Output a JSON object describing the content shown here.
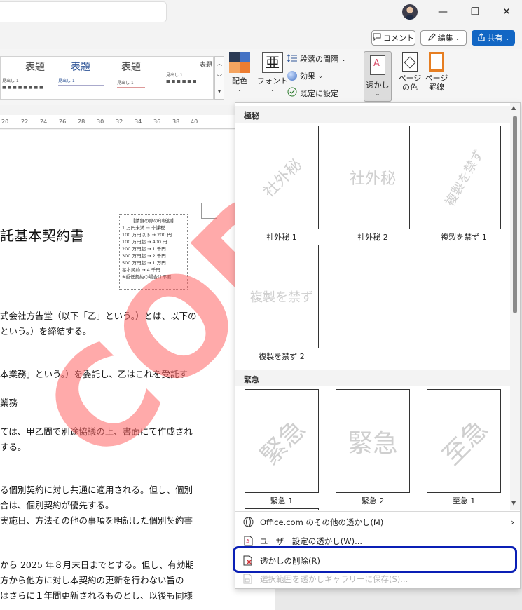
{
  "window": {
    "minimize_glyph": "—",
    "restore_glyph": "❐",
    "close_glyph": "✕"
  },
  "collab": {
    "comment_label": "コメント",
    "edit_label": "編集",
    "share_label": "共有"
  },
  "ribbon": {
    "styles": [
      {
        "title": "表題",
        "sub": "見出し 1"
      },
      {
        "title": "表題",
        "sub": "見出し 1"
      },
      {
        "title": "表題",
        "sub": "見出し 1"
      },
      {
        "title": "表題",
        "sub": "見出し 1"
      }
    ],
    "colors_label": "配色",
    "fonts_label": "フォント",
    "font_glyph": "亜",
    "paragraph_spacing_label": "段落の間隔",
    "effects_label": "効果",
    "set_default_label": "既定に設定",
    "watermark_label": "透かし",
    "page_color_label": "ページの色",
    "page_borders_label": "ページ罫線"
  },
  "ruler": {
    "ticks": [
      "20",
      "22",
      "24",
      "26",
      "28",
      "30",
      "32",
      "34",
      "36",
      "38",
      "40"
    ]
  },
  "document": {
    "title": "託基本契約書",
    "stamp_lines": [
      "【請負の際の印紙額】",
      "1 万円未満 → 非課税",
      "100 万円以下 → 200 円",
      "100 万円超 → 400 円",
      "200 万円超 → 1 千円",
      "300 万円超 → 2 千円",
      "500 万円超 → 1 万円",
      "基本契約 → 4 千円",
      "※委任契約の場合は不要"
    ],
    "lines": [
      "式会社方告堂（以下「乙」という。）とは、以下の",
      "という。）を締結する。",
      "本業務」という。）を委託し、乙はこれを受託す",
      "業務",
      "ては、甲乙間で別途協議の上、書面にて作成され",
      "する。",
      "る個別契約に対し共通に適用される。但し、個別",
      "合は、個別契約が優先する。",
      "実施日、方法その他の事項を明記した個別契約書",
      "から 2025 年８月末日までとする。但し、有効期",
      "方から他方に対し本契約の更新を行わない旨の",
      "はさらに１年間更新されるものとし、以後も同様"
    ],
    "watermark_text": "COPY"
  },
  "watermark_menu": {
    "sections": [
      {
        "heading": "極秘",
        "items": [
          {
            "text": "社外秘",
            "caption": "社外秘 1",
            "style": "diagonal"
          },
          {
            "text": "社外秘",
            "caption": "社外秘 2",
            "style": "horizontal"
          },
          {
            "text": "複製を禁ず",
            "caption": "複製を禁ず 1",
            "style": "diagonal"
          },
          {
            "text": "複製を禁ず",
            "caption": "複製を禁ず 2",
            "style": "horizontal"
          }
        ]
      },
      {
        "heading": "緊急",
        "items": [
          {
            "text": "緊急",
            "caption": "緊急 1",
            "style": "diagonal"
          },
          {
            "text": "緊急",
            "caption": "緊急 2",
            "style": "horizontal"
          },
          {
            "text": "至急",
            "caption": "至急 1",
            "style": "diagonal"
          }
        ]
      }
    ],
    "commands": [
      {
        "label": "Office.com のその他の透かし(M)",
        "enabled": true,
        "has_submenu": true
      },
      {
        "label": "ユーザー設定の透かし(W)...",
        "enabled": true,
        "has_submenu": false
      },
      {
        "label": "透かしの削除(R)",
        "enabled": true,
        "has_submenu": false
      },
      {
        "label": "選択範囲を透かしギャラリーに保存(S)...",
        "enabled": false,
        "has_submenu": false
      }
    ]
  },
  "colors": {
    "accent": "#1266c4",
    "highlight_border": "#0a1fb5",
    "watermark_red": "#ff6464"
  }
}
